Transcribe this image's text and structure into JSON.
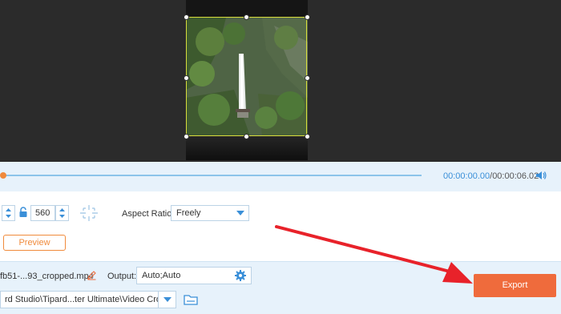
{
  "timeline": {
    "current_time": "00:00:00.00",
    "separator": "/",
    "total_time": "00:00:06.02",
    "progress": 0.0
  },
  "crop": {
    "height_value": "560",
    "aspect_label": "Aspect Ratio:",
    "aspect_value": "Freely"
  },
  "buttons": {
    "preview": "Preview",
    "export": "Export"
  },
  "output": {
    "filename": "fb51-...93_cropped.mp4",
    "label": "Output:",
    "value": "Auto;Auto",
    "path": "rd Studio\\Tipard...ter Ultimate\\Video Crop"
  },
  "colors": {
    "accent_orange": "#ef6b3c",
    "crop_border": "#d8dc3c",
    "time_blue": "#3a8fd8",
    "panel_bg": "#e7f2fb",
    "annotation_arrow": "#e8222a"
  },
  "icons": [
    "spinner-arrows-icon",
    "lock-icon",
    "crosshair-icon",
    "chevron-down-icon",
    "edit-pencil-icon",
    "gear-icon",
    "folder-icon",
    "volume-icon"
  ]
}
